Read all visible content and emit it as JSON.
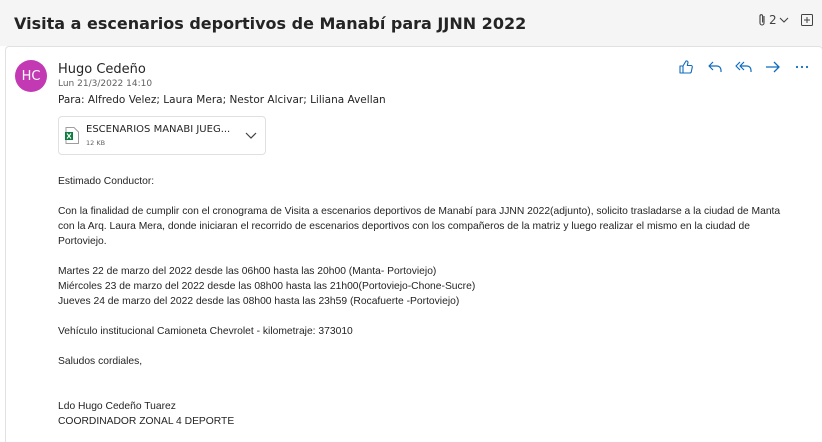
{
  "subject": "Visita a escenarios deportivos de Manabí para JJNN 2022",
  "attachment_count": "2",
  "sender": {
    "initials": "HC",
    "name": "Hugo Cedeño",
    "date": "Lun 21/3/2022 14:10",
    "to": "Para:  Alfredo Velez; Laura Mera; Nestor Alcivar; Liliana Avellan",
    "avatar_color": "#c239b3"
  },
  "attachment": {
    "name": "ESCENARIOS MANABI JUEG...",
    "size": "12 KB",
    "icon": "excel-file-icon"
  },
  "body": {
    "greeting": "Estimado Conductor:",
    "para1": "Con la finalidad de cumplir con el cronograma de Visita a escenarios deportivos de Manabí para JJNN 2022(adjunto), solicito trasladarse a la ciudad de Manta con la Arq. Laura Mera, donde iniciaran el recorrido de escenarios deportivos con los compañeros de la matriz y luego realizar el mismo en la ciudad de Portoviejo.",
    "schedule": [
      "Martes 22 de marzo del 2022 desde las 06h00 hasta las 20h00 (Manta- Portoviejo)",
      "Miércoles 23 de marzo del 2022 desde las 08h00 hasta las 21h00(Portoviejo-Chone-Sucre)",
      "Jueves 24 de marzo del 2022 desde las 08h00 hasta las 23h59 (Rocafuerte -Portoviejo)"
    ],
    "vehicle": "Vehículo institucional Camioneta Chevrolet - kilometraje: 373010",
    "closing": "Saludos cordiales,",
    "signature_name": "Ldo Hugo Cedeño Tuarez",
    "signature_title": "COORDINADOR ZONAL 4 DEPORTE"
  },
  "accent_color": "#0f6cbd"
}
